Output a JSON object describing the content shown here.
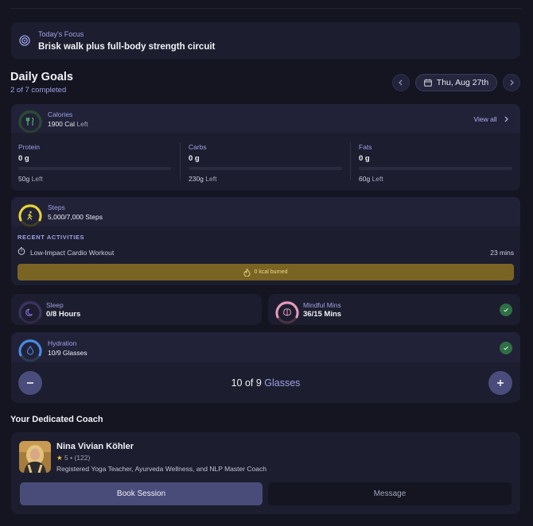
{
  "focus": {
    "label": "Today's Focus",
    "text": "Brisk walk plus full-body strength circuit"
  },
  "daily_goals": {
    "title": "Daily Goals",
    "completed": "2 of 7 completed",
    "date": "Thu, Aug 27th"
  },
  "calories": {
    "label": "Calories",
    "value": "1900 Cal",
    "suffix": "Left",
    "view_all": "View all",
    "macros": [
      {
        "label": "Protein",
        "value": "0 g",
        "left": "50g",
        "left_suffix": "Left"
      },
      {
        "label": "Carbs",
        "value": "0 g",
        "left": "230g",
        "left_suffix": "Left"
      },
      {
        "label": "Fats",
        "value": "0 g",
        "left": "60g",
        "left_suffix": "Left"
      }
    ]
  },
  "steps": {
    "label": "Steps",
    "value": "5,000/7,000 Steps",
    "progress": 0.71,
    "recent_title": "RECENT ACTIVITIES",
    "activity": {
      "name": "Low-Impact Cardio Workout",
      "duration": "23 mins"
    },
    "kcal": "0 kcal burned"
  },
  "sleep": {
    "label": "Sleep",
    "value": "0/8 Hours"
  },
  "mindful": {
    "label": "Mindful Mins",
    "value": "36/15 Mins"
  },
  "hydration": {
    "label": "Hydration",
    "value": "10/9 Glasses",
    "count": "10 of 9",
    "unit": "Glasses"
  },
  "coach": {
    "section_title": "Your Dedicated Coach",
    "name": "Nina Vivian Köhler",
    "rating": "5",
    "reviews": "(122)",
    "description": "Registered Yoga Teacher, Ayurveda Wellness, and NLP Master Coach",
    "book_label": "Book Session",
    "message_label": "Message"
  },
  "colors": {
    "accent": "#9fa1e6",
    "calories_ring": "#3c8a4f",
    "steps_ring": "#e8d43a",
    "sleep_ring": "#6b4bb0",
    "mindful_ring": "#e59bc0",
    "hydration_ring": "#4a8be6",
    "kcal_bar": "#7a6424",
    "check": "#2f6f45"
  },
  "icons": [
    "target-icon",
    "calendar-icon",
    "chevron-left-icon",
    "chevron-right-icon",
    "utensils-icon",
    "walking-icon",
    "timer-icon",
    "flame-icon",
    "moon-icon",
    "brain-icon",
    "droplet-icon",
    "check-icon",
    "minus-icon",
    "plus-icon",
    "star-icon"
  ]
}
